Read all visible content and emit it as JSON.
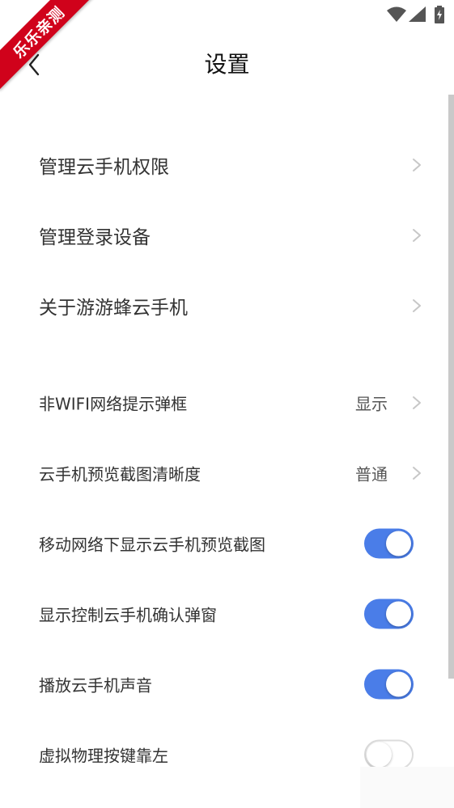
{
  "watermark": "乐乐亲测",
  "header": {
    "title": "设置"
  },
  "section1": [
    {
      "label": "管理云手机权限"
    },
    {
      "label": "管理登录设备"
    },
    {
      "label": "关于游游蜂云手机"
    }
  ],
  "section2": [
    {
      "label": "非WIFI网络提示弹框",
      "value": "显示"
    },
    {
      "label": "云手机预览截图清晰度",
      "value": "普通"
    }
  ],
  "toggles": [
    {
      "label": "移动网络下显示云手机预览截图",
      "on": true
    },
    {
      "label": "显示控制云手机确认弹窗",
      "on": true
    },
    {
      "label": "播放云手机声音",
      "on": true
    },
    {
      "label": "虚拟物理按键靠左",
      "on": false
    }
  ],
  "colors": {
    "accent": "#4a7de8",
    "watermark": "#d0021b",
    "text": "#333333"
  },
  "icons": {
    "status": [
      "wifi-icon",
      "signal-icon",
      "battery-charging-icon"
    ],
    "back": "back-arrow-icon",
    "row_chevron": "chevron-right-icon"
  }
}
